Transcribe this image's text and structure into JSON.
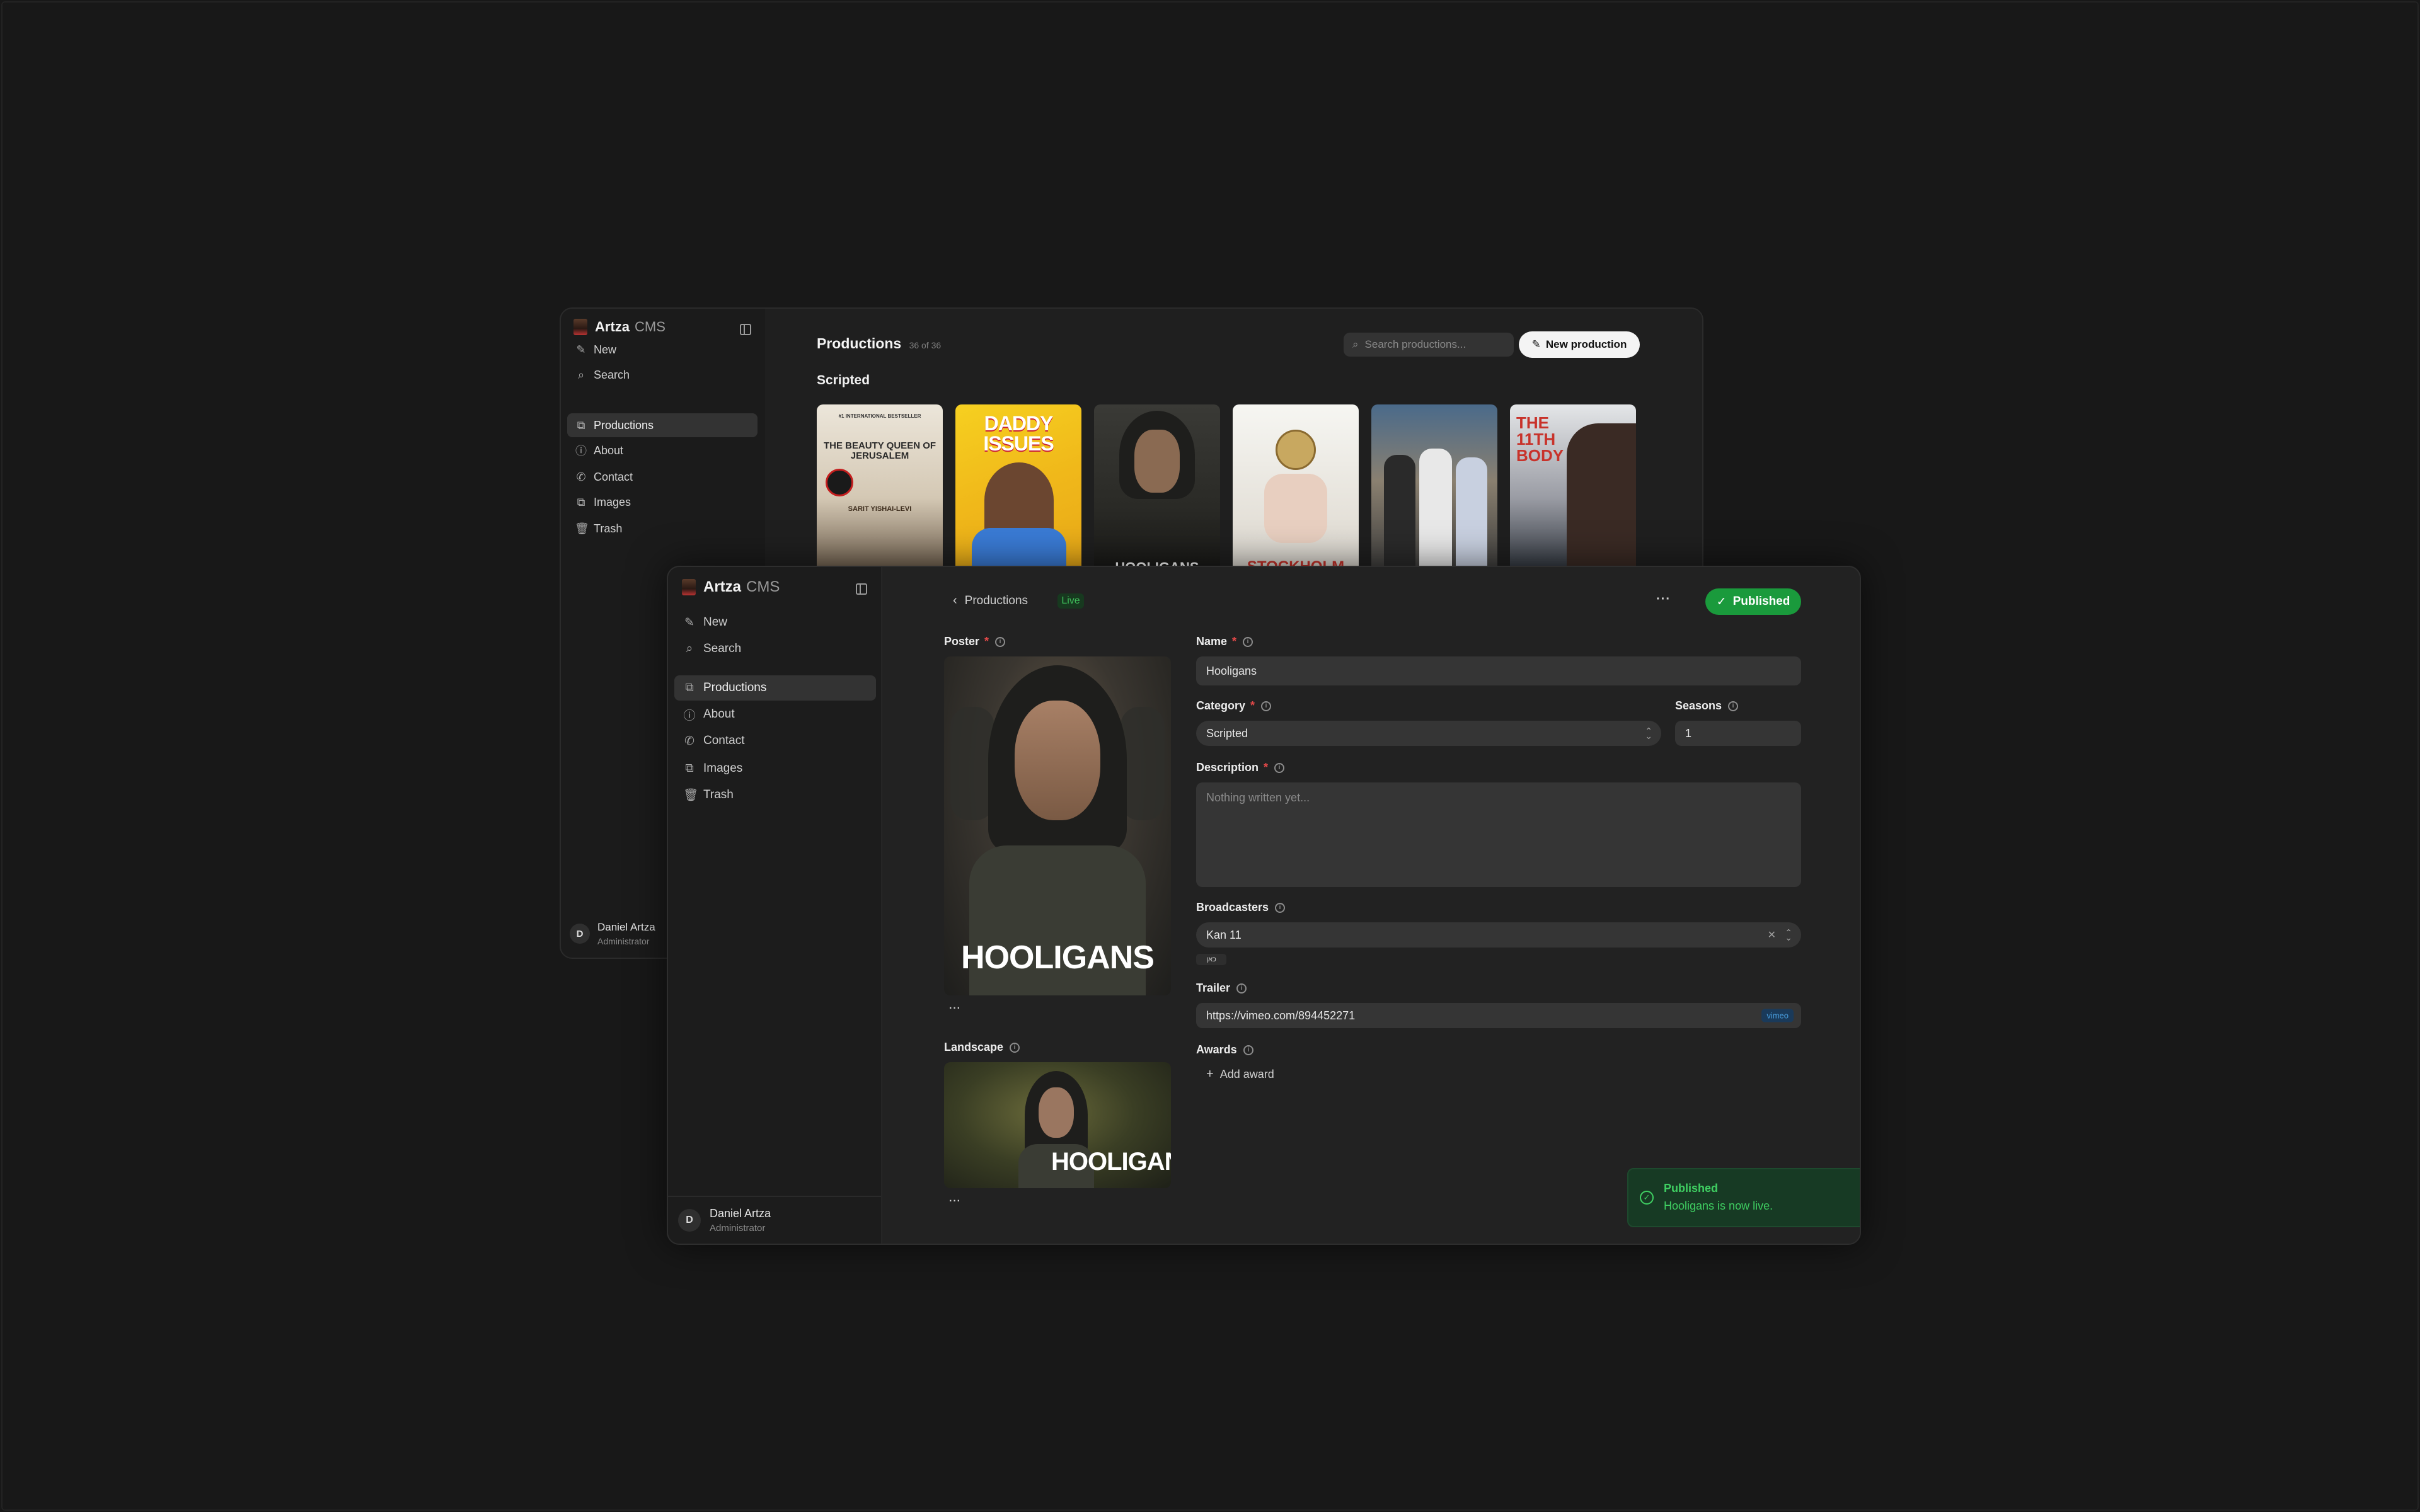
{
  "back_window": {
    "brand": {
      "name": "Artza",
      "suffix": "CMS"
    },
    "nav": [
      {
        "label": "New",
        "icon": "edit-icon"
      },
      {
        "label": "Search",
        "icon": "search-icon"
      },
      {
        "label": "Productions",
        "icon": "productions-icon",
        "active": true
      },
      {
        "label": "About",
        "icon": "info-icon"
      },
      {
        "label": "Contact",
        "icon": "phone-icon"
      },
      {
        "label": "Images",
        "icon": "images-icon"
      },
      {
        "label": "Trash",
        "icon": "trash-icon"
      }
    ],
    "user": {
      "initial": "D",
      "name": "Daniel Artza",
      "role": "Administrator"
    },
    "header": {
      "title": "Productions",
      "count": "36 of 36",
      "search_placeholder": "Search productions...",
      "new_button": "New production"
    },
    "section": "Scripted",
    "posters": [
      {
        "title": "THE BEAUTY QUEEN OF JERUSALEM",
        "top": "#1 INTERNATIONAL BESTSELLER",
        "bottom": "SARIT YISHAI-LEVI",
        "colors": [
          "#e8e2d6",
          "#c4b8a4",
          "#5a4a3a"
        ]
      },
      {
        "title": "DADDY ISSUES",
        "colors": [
          "#f2c51c",
          "#e8a818",
          "#3a7bd5"
        ]
      },
      {
        "title": "HOOLIGANS",
        "colors": [
          "#4a4a44",
          "#2a2a26",
          "#151513"
        ]
      },
      {
        "title": "STOCKHOLM",
        "colors": [
          "#f4f4f0",
          "#d8d4cc",
          "#c8322a"
        ]
      },
      {
        "title": "",
        "colors": [
          "#3a5a7a",
          "#7a7060",
          "#2a2a2a"
        ]
      },
      {
        "title": "THE 11TH BODY",
        "colors": [
          "#d8dce0",
          "#7a7a80",
          "#2a3038"
        ]
      }
    ]
  },
  "front_window": {
    "brand": {
      "name": "Artza",
      "suffix": "CMS"
    },
    "nav": [
      {
        "label": "New",
        "icon": "edit-icon"
      },
      {
        "label": "Search",
        "icon": "search-icon"
      },
      {
        "label": "Productions",
        "icon": "productions-icon",
        "active": true
      },
      {
        "label": "About",
        "icon": "info-icon"
      },
      {
        "label": "Contact",
        "icon": "phone-icon"
      },
      {
        "label": "Images",
        "icon": "images-icon"
      },
      {
        "label": "Trash",
        "icon": "trash-icon"
      }
    ],
    "user": {
      "initial": "D",
      "name": "Daniel Artza",
      "role": "Administrator"
    },
    "breadcrumb": "Productions",
    "status_badge": "Live",
    "more_label": "···",
    "publish_button": "Published",
    "form": {
      "poster_label": "Poster",
      "poster_image_text": "HOOLIGANS",
      "landscape_label": "Landscape",
      "landscape_image_text": "HOOLIGANS",
      "name_label": "Name",
      "name_value": "Hooligans",
      "category_label": "Category",
      "category_value": "Scripted",
      "seasons_label": "Seasons",
      "seasons_value": "1",
      "description_label": "Description",
      "description_placeholder": "Nothing written yet...",
      "broadcasters_label": "Broadcasters",
      "broadcasters_value": "Kan 11",
      "broadcaster_tag": "כאן",
      "trailer_label": "Trailer",
      "trailer_value": "https://vimeo.com/894452271",
      "trailer_badge": "vimeo",
      "awards_label": "Awards",
      "add_award": "Add award"
    },
    "toast": {
      "title": "Published",
      "message": "Hooligans is now live."
    }
  },
  "colors": {
    "accent_green": "#1a9a3c",
    "toast_text": "#3fcf62",
    "required": "#e24848"
  }
}
